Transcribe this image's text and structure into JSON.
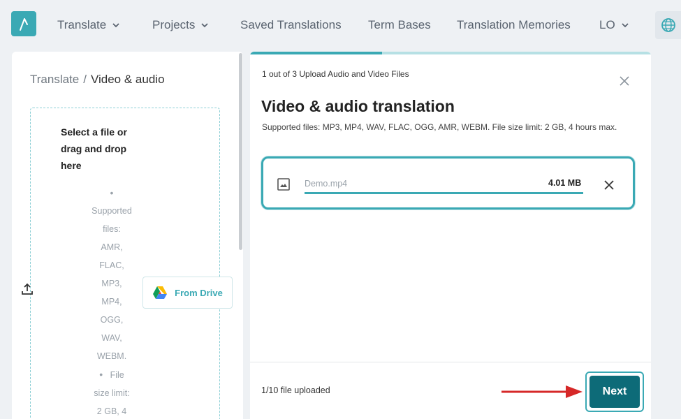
{
  "nav": {
    "items": [
      {
        "label": "Translate",
        "dropdown": true
      },
      {
        "label": "Projects",
        "dropdown": true
      },
      {
        "label": "Saved Translations",
        "dropdown": false
      },
      {
        "label": "Term Bases",
        "dropdown": false
      },
      {
        "label": "Translation Memories",
        "dropdown": false
      },
      {
        "label": "LO",
        "dropdown": true
      }
    ],
    "logo_icon": "lambda-logo-icon",
    "globe_icon": "globe-icon"
  },
  "breadcrumb": {
    "root": "Translate",
    "separator": "/",
    "current": "Video & audio"
  },
  "dropzone": {
    "title": "Select a file or drag and drop here",
    "bullet": "•",
    "supported_lines": [
      "Supported",
      "files:",
      "AMR,",
      "FLAC,",
      "MP3,",
      "MP4,",
      "OGG,",
      "WAV,",
      "WEBM."
    ],
    "limit_lines": [
      "File",
      "size limit:",
      "2 GB, 4"
    ],
    "drive_button": "From Drive"
  },
  "modal": {
    "step": "1 out of 3 Upload Audio and Video Files",
    "step_progress": 0.33,
    "title": "Video & audio translation",
    "subtitle": "Supported files: MP3, MP4, WAV, FLAC, OGG, AMR, WEBM. File size limit: 2 GB, 4 hours max.",
    "file": {
      "name": "Demo.mp4",
      "size": "4.01 MB",
      "progress": 1.0
    },
    "uploaded_status": "1/10 file uploaded",
    "next_button": "Next"
  },
  "colors": {
    "accent": "#3aa9b4",
    "primary_button": "#0d6b78",
    "annotation_arrow": "#d62828"
  }
}
